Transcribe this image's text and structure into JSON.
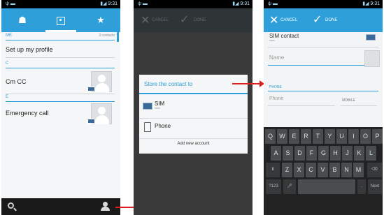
{
  "status": {
    "time": "9:31"
  },
  "contacts_screen": {
    "sections": [
      {
        "label": "ME",
        "count": "3 contacts"
      },
      {
        "label": "C"
      },
      {
        "label": "E"
      }
    ],
    "rows": [
      "Set up my profile",
      "Cm CC",
      "Emergency call"
    ]
  },
  "store_dialog": {
    "toolbar": {
      "cancel": "CANCEL",
      "done": "DONE"
    },
    "title": "Store the contact to",
    "options": [
      {
        "label": "SIM",
        "sub": "****",
        "icon": "sim-card-icon"
      },
      {
        "label": "Phone",
        "icon": "phone-icon"
      }
    ],
    "add_account": "Add new account"
  },
  "edit_screen": {
    "toolbar": {
      "cancel": "CANCEL",
      "done": "DONE"
    },
    "account": {
      "label": "SIM contact",
      "sub": "****"
    },
    "name_placeholder": "Name",
    "phone_section": "PHONE",
    "phone_placeholder": "Phone",
    "phone_type": "MOBILE"
  },
  "keyboard": {
    "row1": [
      "Q",
      "W",
      "E",
      "R",
      "T",
      "Y",
      "U",
      "I",
      "O",
      "P"
    ],
    "row2": [
      "A",
      "S",
      "D",
      "F",
      "G",
      "H",
      "J",
      "K",
      "L"
    ],
    "row3": [
      "Z",
      "X",
      "C",
      "V",
      "B",
      "N",
      "M"
    ],
    "sym": "?123",
    "next": "Next"
  },
  "colors": {
    "accent": "#2e9fd8",
    "arrow": "#e02020",
    "dialog_bg": "#3a3a3a"
  }
}
